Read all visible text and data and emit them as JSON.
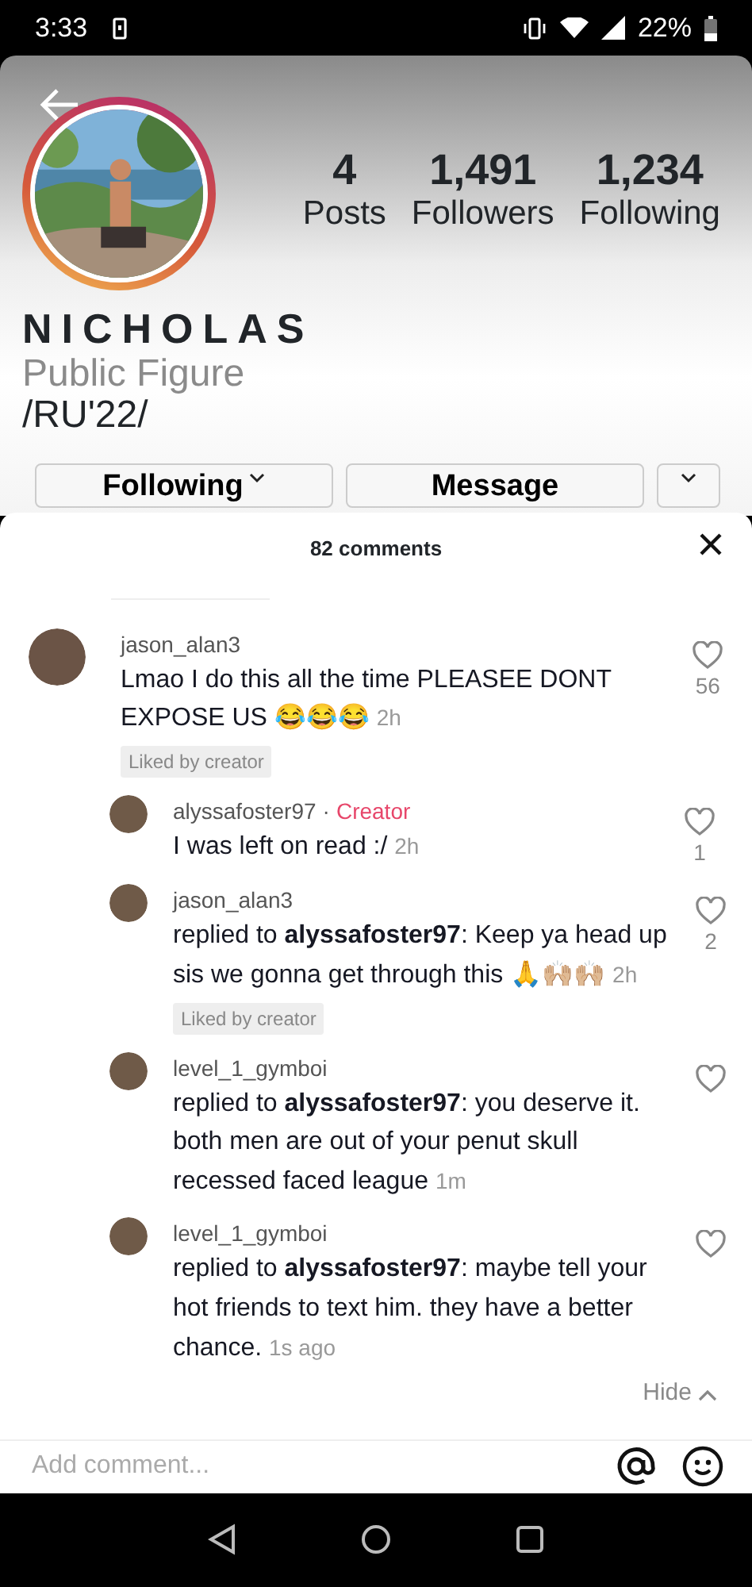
{
  "status_bar": {
    "time": "3:33",
    "battery": "22%"
  },
  "profile": {
    "name": "NICHOLAS",
    "category": "Public Figure",
    "bio": "/RU'22/",
    "stats": [
      {
        "value": "4",
        "label": "Posts"
      },
      {
        "value": "1,491",
        "label": "Followers"
      },
      {
        "value": "1,234",
        "label": "Following"
      }
    ],
    "buttons": [
      {
        "label": "Following",
        "kind": "menu"
      },
      {
        "label": "Message",
        "kind": "plain"
      },
      {
        "kind": "dropdown"
      }
    ]
  },
  "comments_sheet": {
    "title": "82 comments",
    "comments": [
      {
        "user": "jason_alan3",
        "text": "Lmao I do this all the time PLEASEE DONT EXPOSE US 😂😂😂",
        "time": "2h",
        "likes": "56",
        "liked_by_creator": "Liked by creator",
        "replies": [
          {
            "user": "alyssafoster97",
            "tag_separator": "·",
            "tag": "Creator",
            "text": "I was left on read :/",
            "time": "2h",
            "likes": "1"
          },
          {
            "user": "jason_alan3",
            "text": "replied to **alyssafoster97**: Keep ya head up sis we gonna get through this 🙏🙌🏼🙌🏼",
            "time": "2h",
            "likes": "2",
            "liked_by_creator": "Liked by creator"
          },
          {
            "user": "level_1_gymboi",
            "text": "replied to **alyssafoster97**: you deserve it. both men are out of your penut skull recessed faced league",
            "time": "1m"
          },
          {
            "user": "level_1_gymboi",
            "text": "replied to **alyssafoster97**: maybe tell your hot friends to text him. they have a better chance.",
            "time": "1s ago"
          }
        ]
      }
    ],
    "hide_label": "Hide",
    "input": {
      "placeholder": "Add comment..."
    }
  }
}
